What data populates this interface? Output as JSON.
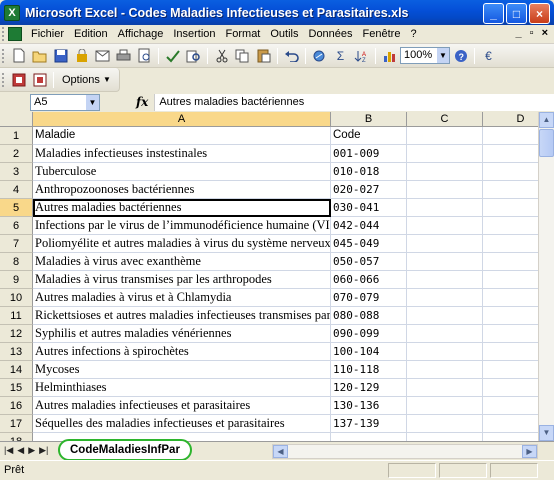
{
  "window": {
    "app_icon_letter": "X",
    "title": "Microsoft Excel - Codes Maladies Infectieuses et Parasitaires.xls",
    "minimize": "_",
    "maximize": "□",
    "close": "×"
  },
  "menu": {
    "items": [
      "Fichier",
      "Edition",
      "Affichage",
      "Insertion",
      "Format",
      "Outils",
      "Données",
      "Fenêtre",
      "?"
    ],
    "right_min": "_",
    "right_restore": "▫",
    "right_close": "×"
  },
  "toolbar": {
    "zoom": "100%",
    "sigma": "Σ",
    "options_label": "Options"
  },
  "formula_bar": {
    "name_box": "A5",
    "fx": "fx",
    "content": "Autres maladies bactériennes"
  },
  "columns": [
    "A",
    "B",
    "C",
    "D"
  ],
  "active_column": "A",
  "active_row": "5",
  "rows": [
    {
      "num": "1",
      "a": "Maladie",
      "b": "Code"
    },
    {
      "num": "2",
      "a": "Maladies infectieuses instestinales",
      "b": "001-009"
    },
    {
      "num": "3",
      "a": "Tuberculose",
      "b": "010-018"
    },
    {
      "num": "4",
      "a": "Anthropozoonoses bactériennes",
      "b": "020-027"
    },
    {
      "num": "5",
      "a": "Autres maladies bactériennes",
      "b": "030-041"
    },
    {
      "num": "6",
      "a": "Infections par le virus de l’immunodéficience humaine (VIH)",
      "b": "042-044"
    },
    {
      "num": "7",
      "a": "Poliomyélite et autres maladies à virus du système nerveux",
      "b": "045-049"
    },
    {
      "num": "8",
      "a": "Maladies à virus avec exanthème",
      "b": "050-057"
    },
    {
      "num": "9",
      "a": "Maladies à virus transmises par les arthropodes",
      "b": "060-066"
    },
    {
      "num": "10",
      "a": "Autres maladies à virus et à Chlamydia",
      "b": "070-079"
    },
    {
      "num": "11",
      "a": "Rickettsioses et autres maladies infectieuses transmises par",
      "b": "080-088"
    },
    {
      "num": "12",
      "a": "Syphilis et autres maladies vénériennes",
      "b": "090-099"
    },
    {
      "num": "13",
      "a": "Autres infections à spirochètes",
      "b": "100-104"
    },
    {
      "num": "14",
      "a": "Mycoses",
      "b": "110-118"
    },
    {
      "num": "15",
      "a": "Helminthiases",
      "b": "120-129"
    },
    {
      "num": "16",
      "a": "Autres maladies infectieuses et parasitaires",
      "b": "130-136"
    },
    {
      "num": "17",
      "a": "Séquelles des maladies infectieuses et parasitaires",
      "b": "137-139"
    },
    {
      "num": "18",
      "a": "",
      "b": ""
    },
    {
      "num": "19",
      "a": "",
      "b": ""
    }
  ],
  "sheet_tab": "CodeMaladiesInfPar",
  "status": "Prêt",
  "colors": {
    "title_blue": "#0550d8",
    "tab_highlight": "#2db52d",
    "active_header": "#f9d88a"
  }
}
